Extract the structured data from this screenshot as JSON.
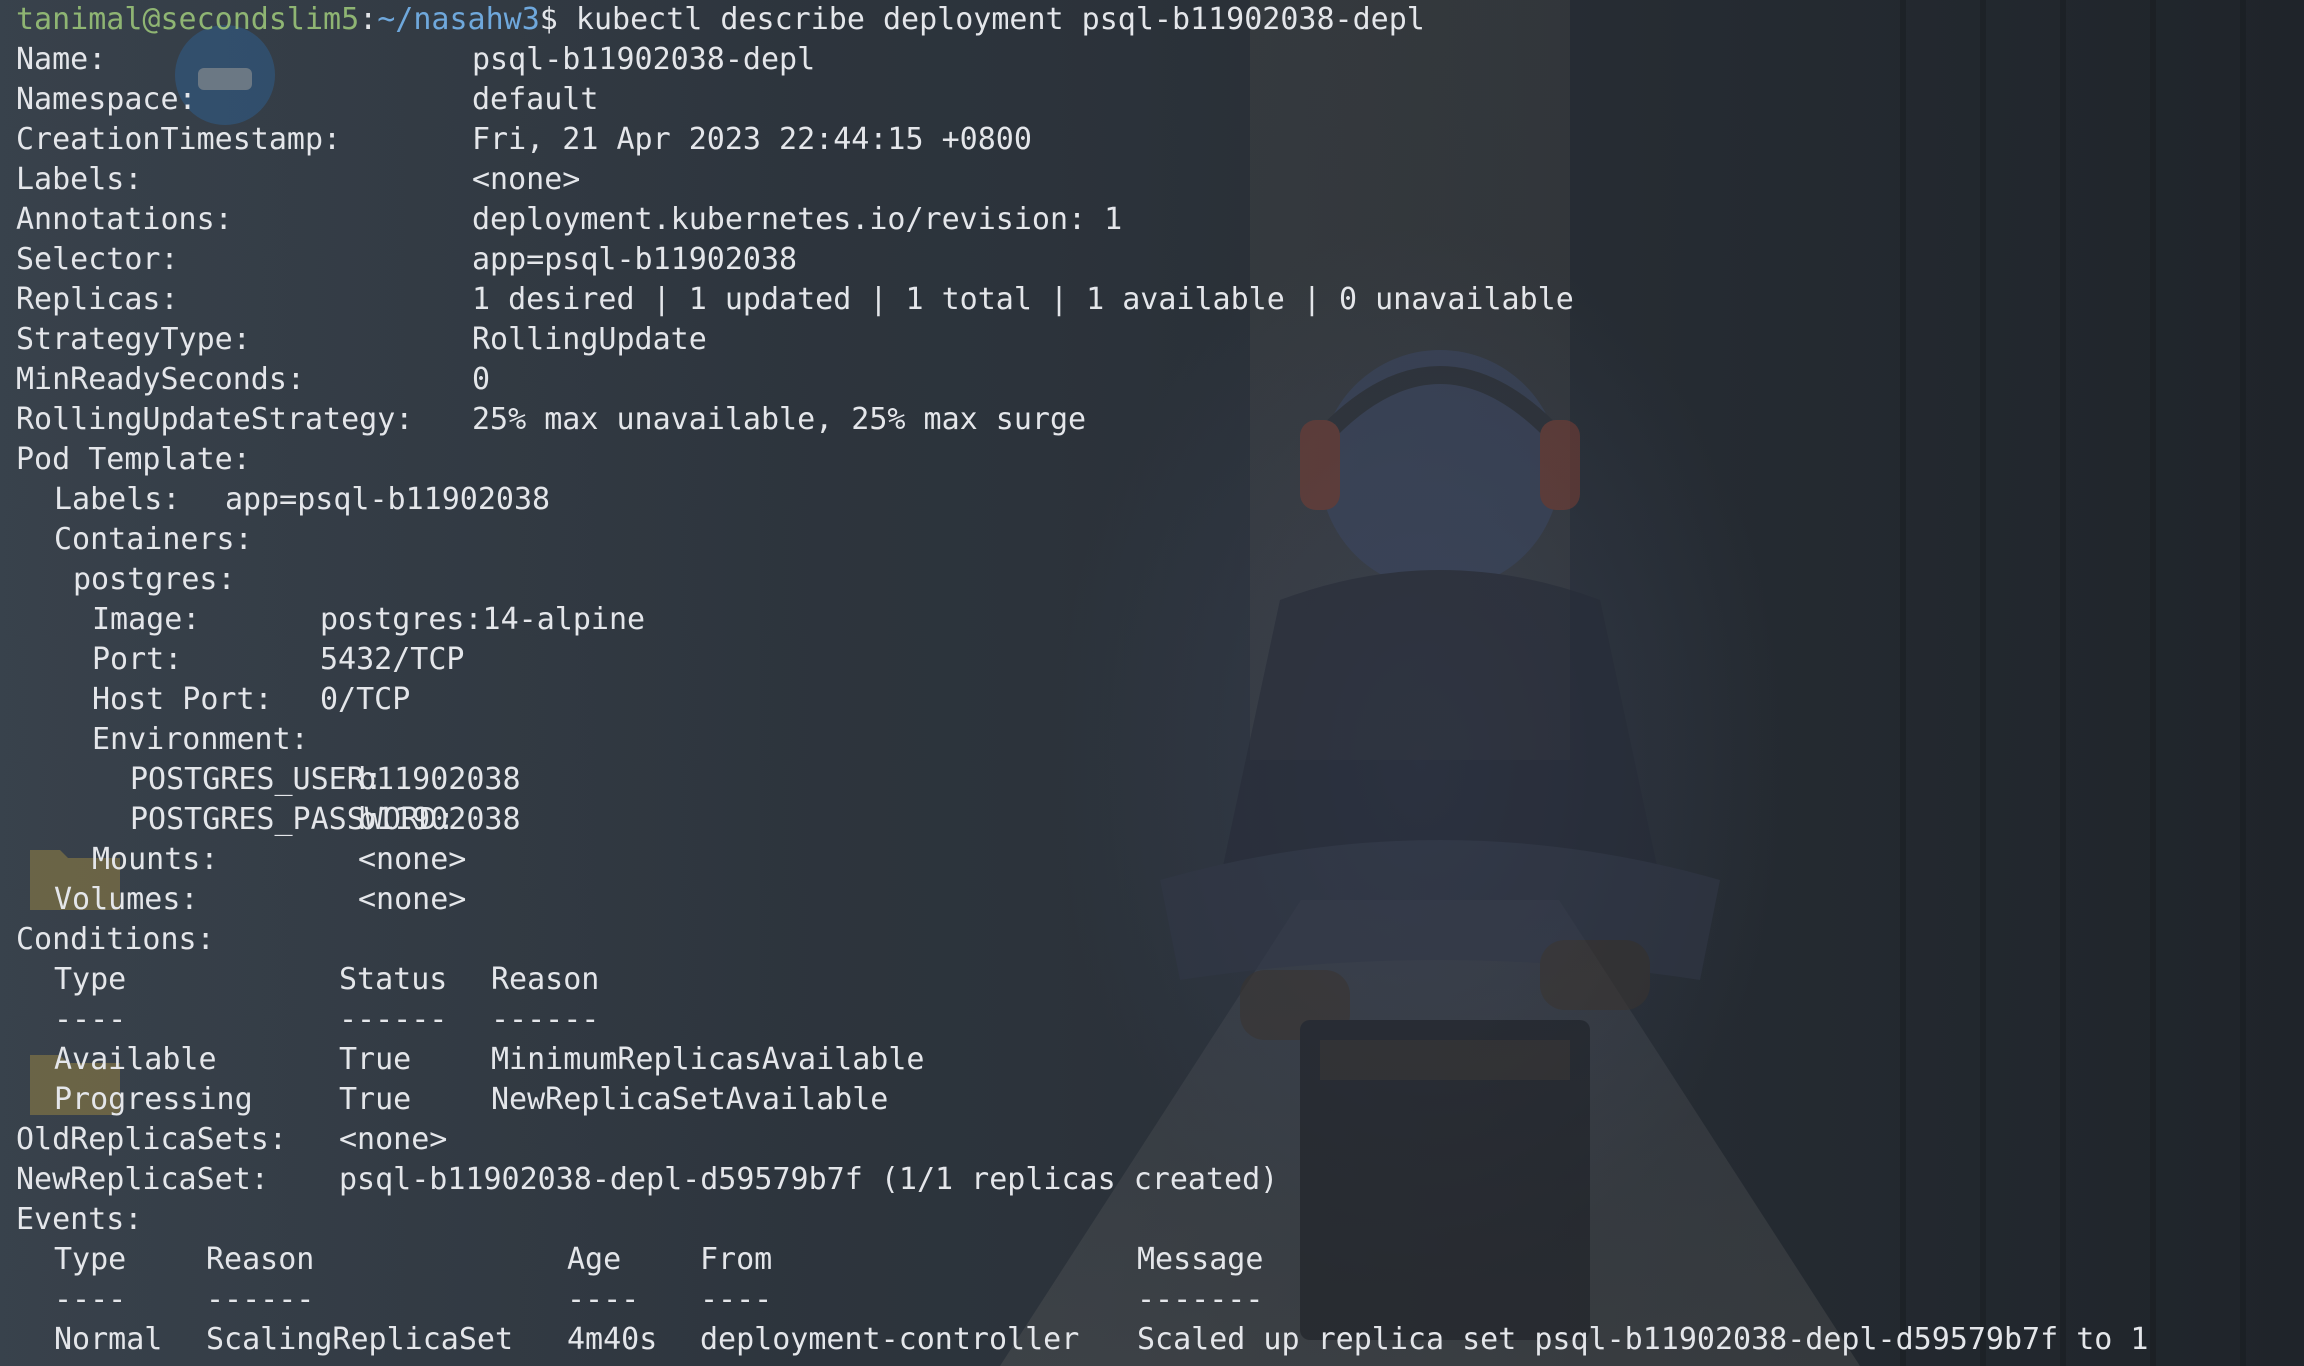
{
  "prompt": {
    "user_host": "tanimal@secondslim5",
    "separator": ":",
    "path": "~/nasahw3",
    "symbol": "$ ",
    "command": "kubectl describe deployment psql-b11902038-depl"
  },
  "fields": {
    "name_key": "Name:",
    "name_val": "psql-b11902038-depl",
    "namespace_key": "Namespace:",
    "namespace_val": "default",
    "creation_key": "CreationTimestamp:",
    "creation_val": "Fri, 21 Apr 2023 22:44:15 +0800",
    "labels_key": "Labels:",
    "labels_val": "<none>",
    "annotations_key": "Annotations:",
    "annotations_val": "deployment.kubernetes.io/revision: 1",
    "selector_key": "Selector:",
    "selector_val": "app=psql-b11902038",
    "replicas_key": "Replicas:",
    "replicas_val": "1 desired | 1 updated | 1 total | 1 available | 0 unavailable",
    "strategy_key": "StrategyType:",
    "strategy_val": "RollingUpdate",
    "minready_key": "MinReadySeconds:",
    "minready_val": "0",
    "rolling_key": "RollingUpdateStrategy:",
    "rolling_val": "25% max unavailable, 25% max surge"
  },
  "pod_template": {
    "heading": "Pod Template:",
    "labels_key": "Labels:",
    "labels_val": "app=psql-b11902038",
    "containers_key": "Containers:",
    "container_name": "postgres:",
    "image_key": "Image:",
    "image_val": "postgres:14-alpine",
    "port_key": "Port:",
    "port_val": "5432/TCP",
    "hostport_key": "Host Port:",
    "hostport_val": "0/TCP",
    "env_key": "Environment:",
    "env_user_key": "POSTGRES_USER:",
    "env_user_val": "b11902038",
    "env_pass_key": "POSTGRES_PASSWORD:",
    "env_pass_val": "b11902038",
    "mounts_key": "Mounts:",
    "mounts_val": "<none>",
    "volumes_key": "Volumes:",
    "volumes_val": "<none>"
  },
  "conditions": {
    "heading": "Conditions:",
    "headers": [
      "Type",
      "Status",
      "Reason"
    ],
    "dashes": [
      "----",
      "------",
      "------"
    ],
    "rows": [
      [
        "Available",
        "True",
        "MinimumReplicasAvailable"
      ],
      [
        "Progressing",
        "True",
        "NewReplicaSetAvailable"
      ]
    ]
  },
  "replicasets": {
    "old_key": "OldReplicaSets:",
    "old_val": "<none>",
    "new_key": "NewReplicaSet:",
    "new_val": "psql-b11902038-depl-d59579b7f (1/1 replicas created)"
  },
  "events": {
    "heading": "Events:",
    "headers": [
      "Type",
      "Reason",
      "Age",
      "From",
      "Message"
    ],
    "dashes": [
      "----",
      "------",
      "----",
      "----",
      "-------"
    ],
    "rows": [
      [
        "Normal",
        "ScalingReplicaSet",
        "4m40s",
        "deployment-controller",
        "Scaled up replica set psql-b11902038-depl-d59579b7f to 1"
      ]
    ]
  }
}
